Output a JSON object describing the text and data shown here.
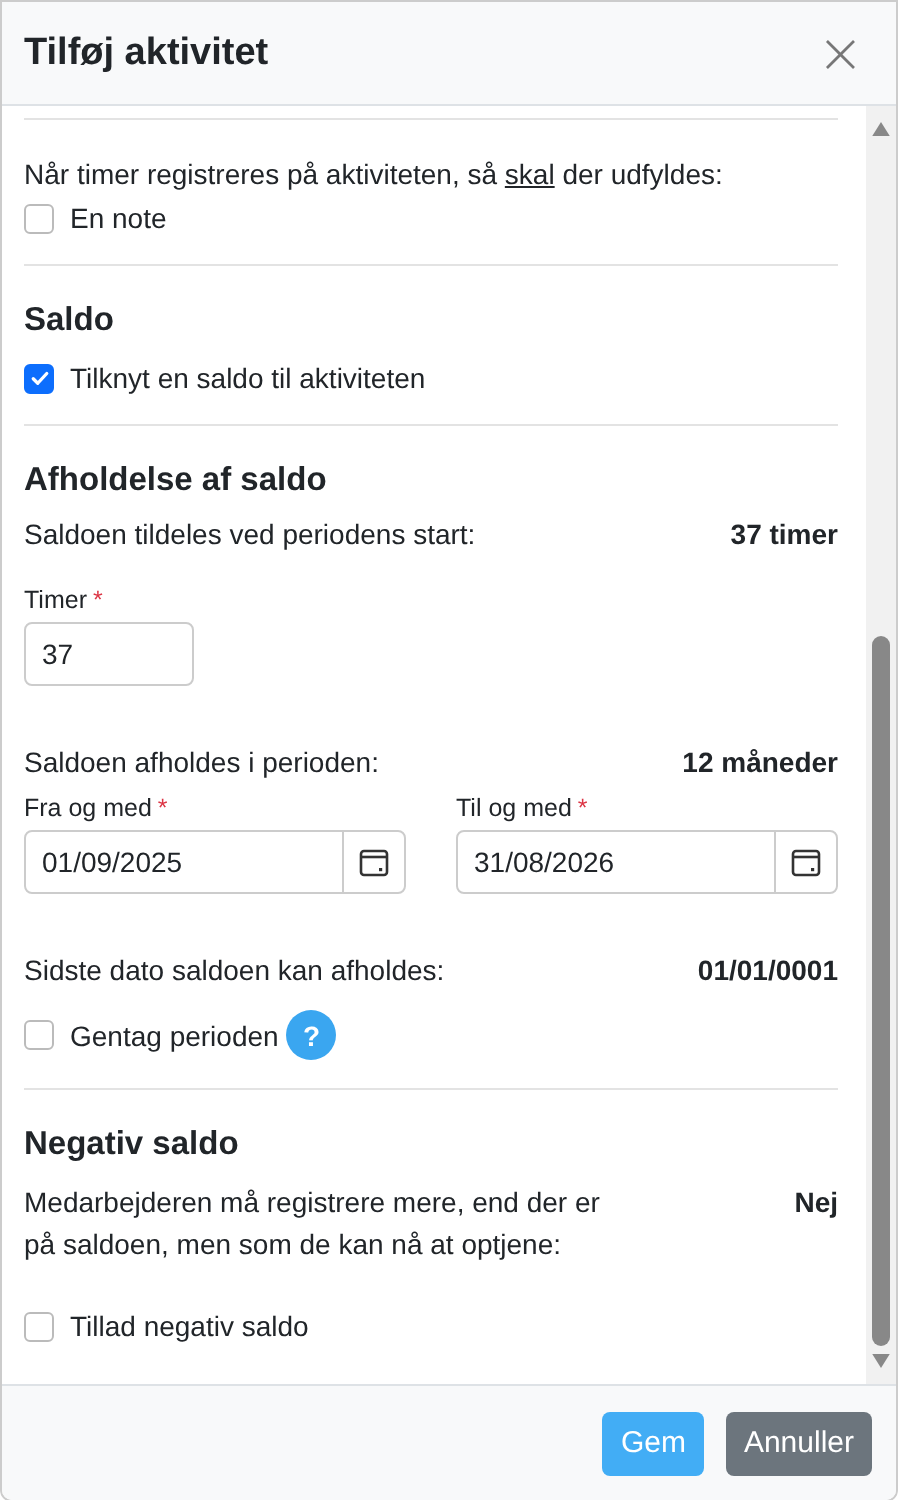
{
  "dialog": {
    "title": "Tilføj aktivitet",
    "close": "×"
  },
  "note_rule": {
    "prefix": "Når timer registreres på aktiviteten, så ",
    "emphasis": "skal",
    "suffix": " der udfyldes:"
  },
  "note_option": {
    "label": "En note",
    "checked": false
  },
  "saldo": {
    "heading": "Saldo",
    "option": {
      "label": "Tilknyt en saldo til aktiviteten",
      "checked": true
    }
  },
  "afholdelse": {
    "heading": "Afholdelse af saldo",
    "grant": {
      "label": "Saldoen tildeles ved periodens start:",
      "value": "37 timer"
    },
    "hours": {
      "label": "Timer",
      "required": "*",
      "value": "37"
    },
    "period": {
      "label": "Saldoen afholdes i perioden:",
      "value": "12 måneder"
    },
    "dates": [
      {
        "label": "Fra og med",
        "required": "*",
        "value": "01/09/2025"
      },
      {
        "label": "Til og med",
        "required": "*",
        "value": "31/08/2026"
      }
    ],
    "last_date": {
      "label": "Sidste dato saldoen kan afholdes:",
      "value": "01/01/0001"
    },
    "repeat": {
      "label": "Gentag perioden",
      "checked": false,
      "help": "?"
    }
  },
  "negativ": {
    "heading": "Negativ saldo",
    "rule": {
      "label": "Medarbejderen må registrere mere, end der er på saldoen, men som de kan nå at optjene:",
      "value": "Nej"
    },
    "option": {
      "label": "Tillad negativ saldo",
      "checked": false
    }
  },
  "buttons": [
    {
      "label": "Gem",
      "kind": "primary"
    },
    {
      "label": "Annuller",
      "kind": "secondary"
    }
  ]
}
